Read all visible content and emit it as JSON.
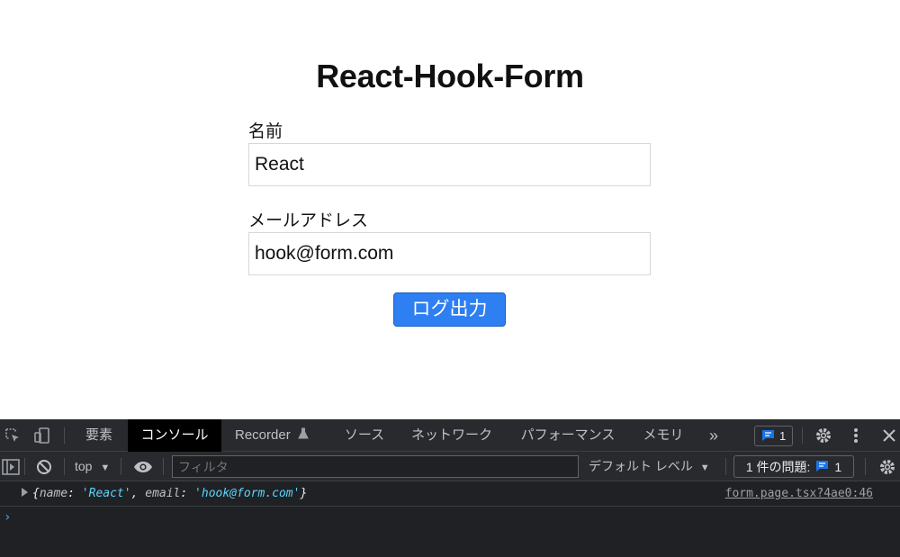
{
  "form": {
    "title": "React-Hook-Form",
    "name_label": "名前",
    "name_value": "React",
    "email_label": "メールアドレス",
    "email_value": "hook@form.com",
    "submit_label": "ログ出力"
  },
  "devtools": {
    "tabs": [
      {
        "label": "要素",
        "active": false
      },
      {
        "label": "コンソール",
        "active": true
      },
      {
        "label": "Recorder",
        "active": false
      },
      {
        "label": "ソース",
        "active": false
      },
      {
        "label": "ネットワーク",
        "active": false
      },
      {
        "label": "パフォーマンス",
        "active": false
      },
      {
        "label": "メモリ",
        "active": false
      }
    ],
    "more_tabs": "»",
    "message_count": "1",
    "context": "top",
    "context_arrow": "▼",
    "filter_placeholder": "フィルタ",
    "level": "デフォルト レベル",
    "level_arrow": "▼",
    "issues_label": "1 件の問題:",
    "issues_count": "1",
    "log": {
      "open": "{",
      "key1": "name",
      "val1": "'React'",
      "key2": "email",
      "val2": "'hook@form.com'",
      "close": "}",
      "source": "form.page.tsx?4ae0:46"
    },
    "prompt": "›",
    "colors": {
      "panel_bg": "#202124",
      "toolbar_bg": "#292a2d",
      "string": "#5cd5fb",
      "accent": "#4d9ff2",
      "button": "#2d7ff2"
    }
  }
}
